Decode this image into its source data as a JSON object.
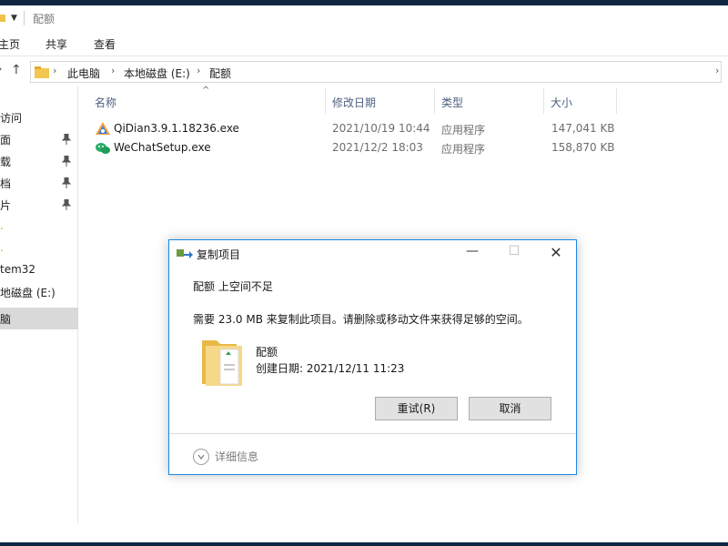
{
  "window": {
    "title": "配额"
  },
  "ribbon": {
    "tabs": [
      "主页",
      "共享",
      "查看"
    ]
  },
  "address": {
    "crumbs": [
      "此电脑",
      "本地磁盘 (E:)",
      "配额"
    ]
  },
  "navpane": {
    "items": [
      {
        "label": "访问",
        "pinned": false
      },
      {
        "label": "面",
        "pinned": true
      },
      {
        "label": "载",
        "pinned": true
      },
      {
        "label": "档",
        "pinned": true
      },
      {
        "label": "片",
        "pinned": true
      },
      {
        "label": "tem32",
        "pinned": false
      },
      {
        "label": "地磁盘 (E:)",
        "pinned": false
      },
      {
        "label": "脑",
        "pinned": false
      }
    ]
  },
  "filelist": {
    "columns": {
      "name": "名称",
      "modified": "修改日期",
      "type": "类型",
      "size": "大小"
    },
    "rows": [
      {
        "name": "QiDian3.9.1.18236.exe",
        "modified": "2021/10/19 10:44",
        "type": "应用程序",
        "size": "147,041 KB",
        "icon": "qidian-app-icon"
      },
      {
        "name": "WeChatSetup.exe",
        "modified": "2021/12/2 18:03",
        "type": "应用程序",
        "size": "158,870 KB",
        "icon": "wechat-app-icon"
      }
    ]
  },
  "dialog": {
    "title": "复制项目",
    "heading": "配额 上空间不足",
    "message": "需要 23.0 MB 来复制此项目。请删除或移动文件来获得足够的空间。",
    "item_name": "配额",
    "item_date": "创建日期: 2021/12/11 11:23",
    "retry_label": "重试(R)",
    "cancel_label": "取消",
    "details_label": "详细信息",
    "accent_color": "#1e88e5"
  }
}
